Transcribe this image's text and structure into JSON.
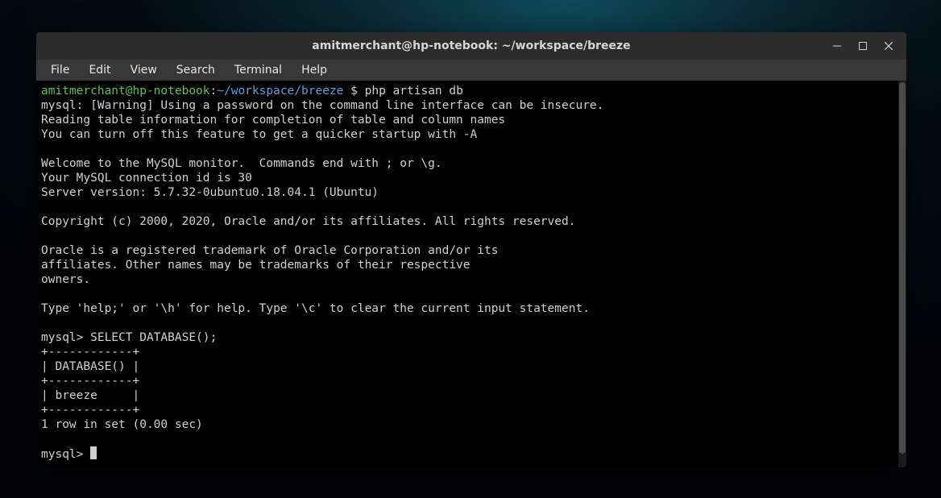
{
  "window": {
    "title": "amitmerchant@hp-notebook: ~/workspace/breeze"
  },
  "menubar": {
    "items": [
      "File",
      "Edit",
      "View",
      "Search",
      "Terminal",
      "Help"
    ]
  },
  "prompt": {
    "userhost": "amitmerchant@hp-notebook",
    "colon": ":",
    "tilde": "~",
    "slash1": "/",
    "seg1": "workspace",
    "slash2": "/",
    "seg2": "breeze",
    "dollar": " $ ",
    "command": "php artisan db"
  },
  "lines": {
    "l0": "mysql: [Warning] Using a password on the command line interface can be insecure.",
    "l1": "Reading table information for completion of table and column names",
    "l2": "You can turn off this feature to get a quicker startup with -A",
    "l3": "",
    "l4": "Welcome to the MySQL monitor.  Commands end with ; or \\g.",
    "l5": "Your MySQL connection id is 30",
    "l6": "Server version: 5.7.32-0ubuntu0.18.04.1 (Ubuntu)",
    "l7": "",
    "l8": "Copyright (c) 2000, 2020, Oracle and/or its affiliates. All rights reserved.",
    "l9": "",
    "l10": "Oracle is a registered trademark of Oracle Corporation and/or its",
    "l11": "affiliates. Other names may be trademarks of their respective",
    "l12": "owners.",
    "l13": "",
    "l14": "Type 'help;' or '\\h' for help. Type '\\c' to clear the current input statement.",
    "l15": "",
    "l16": "mysql> SELECT DATABASE();",
    "l17": "+------------+",
    "l18": "| DATABASE() |",
    "l19": "+------------+",
    "l20": "| breeze     |",
    "l21": "+------------+",
    "l22": "1 row in set (0.00 sec)",
    "l23": "",
    "l24": "mysql> "
  }
}
